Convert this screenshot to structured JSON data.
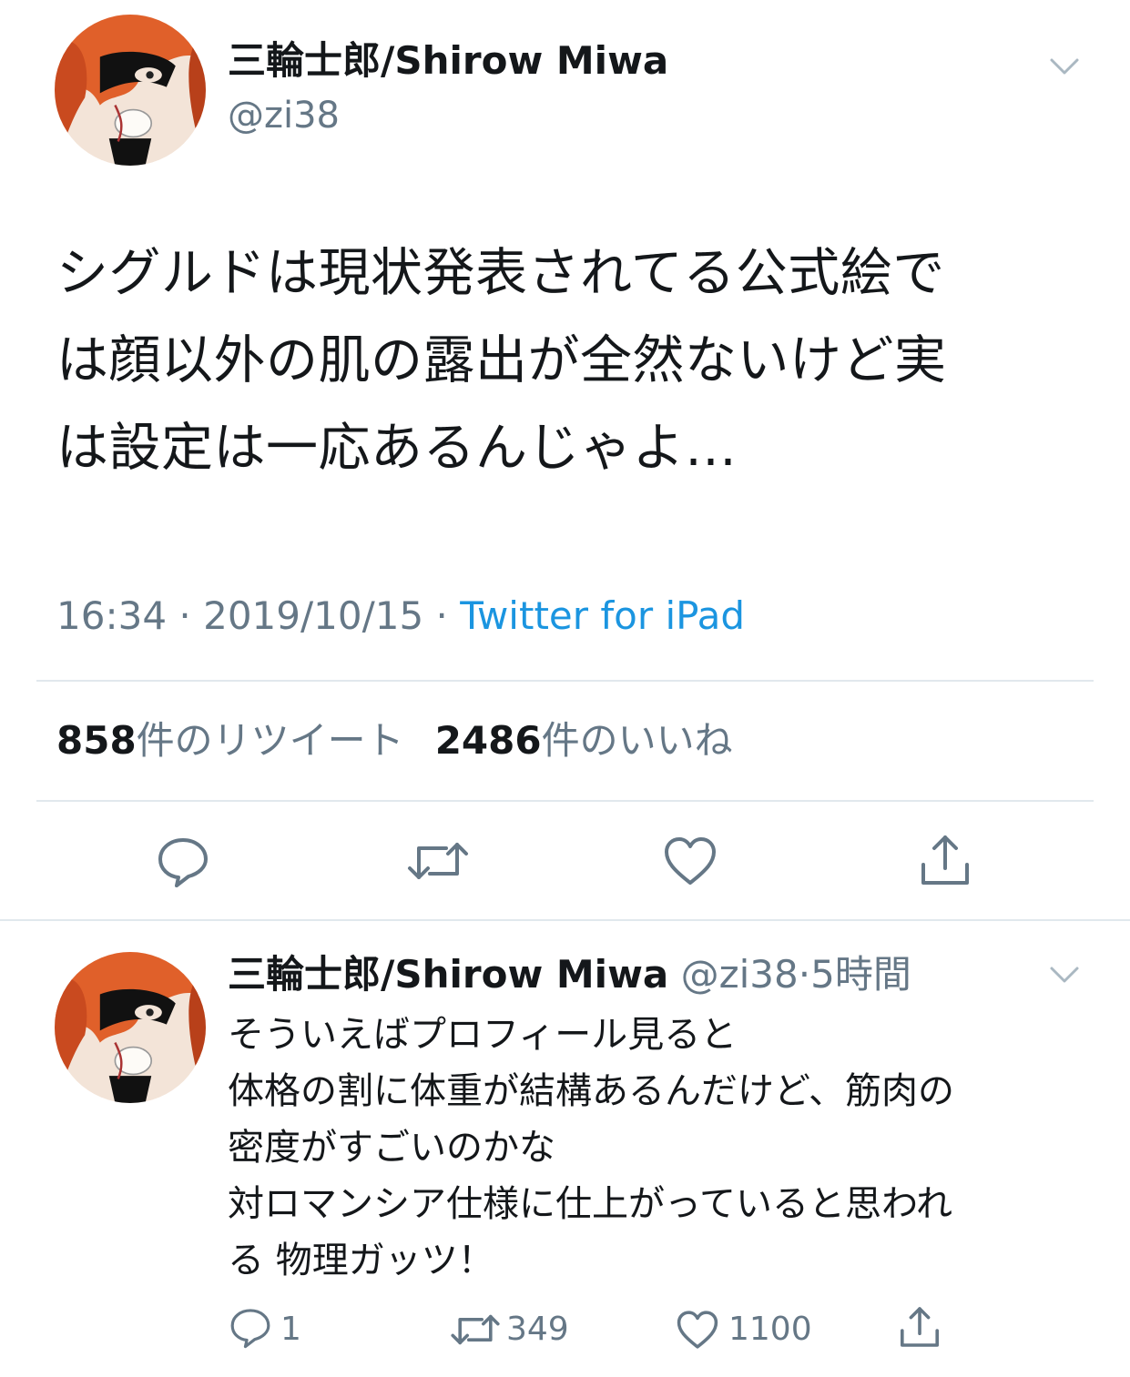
{
  "tweet": {
    "author_name": "三輪士郎/Shirow Miwa",
    "author_handle": "@zi38",
    "text": "シグルドは現状発表されてる公式絵で\nは顔以外の肌の露出が全然ないけど実\nは設定は一応あるんじゃよ…",
    "time": "16:34",
    "date": "2019/10/15",
    "separator": " · ",
    "source": "Twitter for iPad",
    "retweet_count": "858",
    "retweet_label": "件のリツイート",
    "like_count": "2486",
    "like_label": "件のいいね"
  },
  "reply": {
    "author_name": "三輪士郎/Shirow Miwa",
    "author_handle": "@zi38",
    "separator": "·",
    "age": "5時間",
    "text": "そういえばプロフィール見ると\n体格の割に体重が結構あるんだけど、筋肉の\n密度がすごいのかな\n対ロマンシア仕様に仕上がっていると思われ\nる 物理ガッツ！",
    "reply_count": "1",
    "retweet_count": "349",
    "like_count": "1100"
  },
  "icons": {
    "menu": "chevron-down-icon",
    "reply": "speech-bubble-icon",
    "retweet": "retweet-arrows-icon",
    "like": "heart-icon",
    "share": "share-upload-icon"
  },
  "colors": {
    "text": "#14171a",
    "secondary": "#657786",
    "link": "#1b95e0",
    "divider": "#e1e8ed"
  }
}
